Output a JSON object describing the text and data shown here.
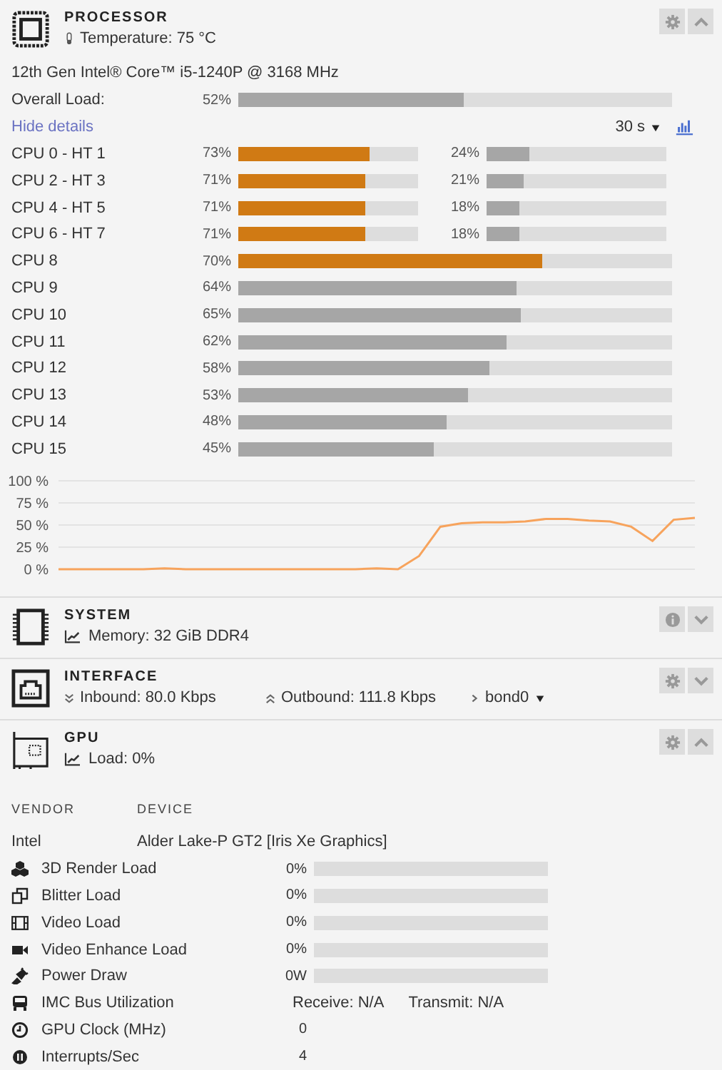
{
  "processor": {
    "kind": "processor",
    "title": "PROCESSOR",
    "temperature": "Temperature: 75 °C",
    "expanded": true,
    "model": "12th Gen Intel® Core™ i5-1240P @ 3168 MHz",
    "overall": {
      "label": "Overall Load:",
      "reading": "52%",
      "level": 0.52
    },
    "details_link": "Hide details",
    "interval": "30 s",
    "cpus": [
      {
        "name": "CPU 0 - HT 1",
        "bars": [
          {
            "reading": "73%",
            "level": 0.73,
            "color": "#d07a14"
          },
          {
            "reading": "24%",
            "level": 0.24,
            "color": "#a6a6a6"
          }
        ]
      },
      {
        "name": "CPU 2 - HT 3",
        "bars": [
          {
            "reading": "71%",
            "level": 0.71,
            "color": "#d07a14"
          },
          {
            "reading": "21%",
            "level": 0.21,
            "color": "#a6a6a6"
          }
        ]
      },
      {
        "name": "CPU 4 - HT 5",
        "bars": [
          {
            "reading": "71%",
            "level": 0.71,
            "color": "#d07a14"
          },
          {
            "reading": "18%",
            "level": 0.18,
            "color": "#a6a6a6"
          }
        ]
      },
      {
        "name": "CPU 6 - HT 7",
        "bars": [
          {
            "reading": "71%",
            "level": 0.71,
            "color": "#d07a14"
          },
          {
            "reading": "18%",
            "level": 0.18,
            "color": "#a6a6a6"
          }
        ]
      },
      {
        "name": "CPU 8",
        "bars": [
          {
            "reading": "70%",
            "level": 0.7,
            "color": "#d07a14"
          }
        ]
      },
      {
        "name": "CPU 9",
        "bars": [
          {
            "reading": "64%",
            "level": 0.64,
            "color": "#a6a6a6"
          }
        ]
      },
      {
        "name": "CPU 10",
        "bars": [
          {
            "reading": "65%",
            "level": 0.65,
            "color": "#a6a6a6"
          }
        ]
      },
      {
        "name": "CPU 11",
        "bars": [
          {
            "reading": "62%",
            "level": 0.62,
            "color": "#a6a6a6"
          }
        ]
      },
      {
        "name": "CPU 12",
        "bars": [
          {
            "reading": "58%",
            "level": 0.58,
            "color": "#a6a6a6"
          }
        ]
      },
      {
        "name": "CPU 13",
        "bars": [
          {
            "reading": "53%",
            "level": 0.53,
            "color": "#a6a6a6"
          }
        ]
      },
      {
        "name": "CPU 14",
        "bars": [
          {
            "reading": "48%",
            "level": 0.48,
            "color": "#a6a6a6"
          }
        ]
      },
      {
        "name": "CPU 15",
        "bars": [
          {
            "reading": "45%",
            "level": 0.45,
            "color": "#a6a6a6"
          }
        ]
      }
    ],
    "chart_data": {
      "type": "line",
      "grid": true,
      "ylim": [
        0,
        100
      ],
      "yticks": [
        {
          "value": 0,
          "label": "0 %"
        },
        {
          "value": 25,
          "label": "25 %"
        },
        {
          "value": 50,
          "label": "50 %"
        },
        {
          "value": 75,
          "label": "75 %"
        },
        {
          "value": 100,
          "label": "100 %"
        }
      ],
      "series": [
        {
          "color": "#f7a35c",
          "values": [
            0,
            0,
            0,
            0,
            0,
            1,
            0,
            0,
            0,
            0,
            0,
            0,
            0,
            0,
            0,
            1,
            0,
            15,
            48,
            52,
            53,
            53,
            54,
            57,
            57,
            55,
            54,
            48,
            32,
            56,
            58
          ]
        }
      ]
    }
  },
  "system": {
    "kind": "system",
    "title": "SYSTEM",
    "memory": "Memory: 32 GiB DDR4",
    "expanded": false
  },
  "interface": {
    "kind": "interface",
    "title": "INTERFACE",
    "inbound": "Inbound: 80.0 Kbps",
    "outbound": "Outbound: 111.8 Kbps",
    "device": "bond0",
    "expanded": false
  },
  "gpu": {
    "kind": "gpu",
    "title": "GPU",
    "load": "Load: 0%",
    "expanded": true,
    "columns": [
      "VENDOR",
      "DEVICE"
    ],
    "vendor": "Intel",
    "device": "Alder Lake-P GT2 [Iris Xe Graphics]",
    "metrics": [
      {
        "kind": "bar",
        "label": "3D Render Load",
        "reading": "0%",
        "level": 0
      },
      {
        "kind": "bar",
        "label": "Blitter Load",
        "reading": "0%",
        "level": 0
      },
      {
        "kind": "bar",
        "label": "Video Load",
        "reading": "0%",
        "level": 0
      },
      {
        "kind": "bar",
        "label": "Video Enhance Load",
        "reading": "0%",
        "level": 0
      },
      {
        "kind": "bar",
        "label": "Power Draw",
        "reading": "0W",
        "level": 0
      },
      {
        "kind": "rates",
        "label": "IMC Bus Utilization",
        "receive": "Receive: N/A",
        "transmit": "Transmit: N/A"
      },
      {
        "kind": "value",
        "label": "GPU Clock (MHz)",
        "reading": "0"
      },
      {
        "kind": "value",
        "label": "Interrupts/Sec",
        "reading": "4"
      }
    ]
  }
}
